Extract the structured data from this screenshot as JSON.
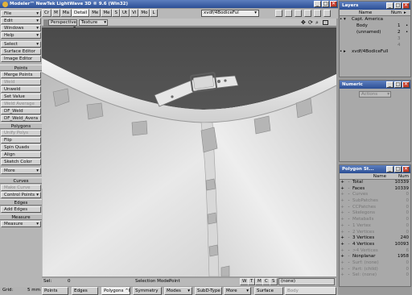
{
  "title_bar": {
    "title": "Modeler™ NewTek LightWave 3D ® 9.6  (Win32)",
    "controls": [
      "_",
      "□",
      "✕"
    ]
  },
  "tabs": [
    "Cr",
    "M",
    "Ma",
    "Me",
    "Me",
    "S",
    "Ut",
    "Vi",
    "Mo",
    "L"
  ],
  "layer_select": "xvdf/4BodiceFul",
  "left_menu": {
    "top": [
      "File",
      "Edit",
      "Windows",
      "Help"
    ],
    "tools": [
      "Select",
      "Surface Editor",
      "Image Editor"
    ],
    "points_header": "Points",
    "points": [
      "Merge Points",
      "Weld",
      "Unweld",
      "Set Value",
      "Weld Average",
      "DF_Weld",
      "DF_Weld_Avera"
    ],
    "points_disabled": [
      false,
      true,
      false,
      false,
      true,
      false,
      false
    ],
    "polygons_header": "Polygons",
    "polygons": [
      "Unify Polys",
      "Flip",
      "Spin Quads",
      "Align",
      "Sketch Color"
    ],
    "polygons_disabled": [
      true,
      false,
      false,
      false,
      false
    ],
    "more1": "More",
    "curves_header": "Curves",
    "curves": [
      "Make Curve",
      "Control Points"
    ],
    "edges_header": "Edges",
    "edges": [
      "Add Edges"
    ],
    "measure_header": "Measure",
    "measure": [
      "Measure"
    ]
  },
  "viewport": {
    "view_type": "Perspective",
    "shading": "Texture",
    "toggle": "Detail"
  },
  "status": {
    "sel_label": "Sel:",
    "sel_value": "0",
    "mode_label": "Selection Mode:",
    "mode_value": "Point",
    "buttons": [
      "W",
      "T",
      "M",
      "C",
      "S"
    ],
    "none": "(none)"
  },
  "bottom": {
    "grid_label": "Grid:",
    "grid_value": "5 mm",
    "points": "Points",
    "edges": "Edges",
    "polygons": "Polygons",
    "ph": "^H",
    "symmetry": "Symmetry",
    "modes": "Modes",
    "subd": "SubD-Type",
    "more": "More",
    "surface": "Surface",
    "surface_value": "Body"
  },
  "layers": {
    "title": "Layers",
    "col_name": "Name",
    "col_num": "Num",
    "rows": [
      {
        "name": "Capt. America",
        "num": ""
      },
      {
        "name": "Body",
        "num": "1"
      },
      {
        "name": "(unnamed)",
        "num": "2"
      },
      {
        "name": "",
        "num": "3"
      },
      {
        "name": "",
        "num": "4"
      },
      {
        "name": "xvdf/4BodiceFull",
        "num": ""
      }
    ]
  },
  "numeric": {
    "title": "Numeric",
    "actions": "Actions"
  },
  "poly_stats": {
    "title": "Polygon St...",
    "col_name": "Name",
    "col_num": "Num",
    "rows": [
      {
        "name": "Total",
        "num": "10339",
        "dim": false
      },
      {
        "name": "Faces",
        "num": "10339",
        "dim": false
      },
      {
        "name": "Curves",
        "num": "0",
        "dim": true
      },
      {
        "name": "SubPatches",
        "num": "0",
        "dim": true
      },
      {
        "name": "CCPatches",
        "num": "0",
        "dim": true
      },
      {
        "name": "Skelegons",
        "num": "0",
        "dim": true
      },
      {
        "name": "Metaballs",
        "num": "0",
        "dim": true
      },
      {
        "name": "1 Vertex",
        "num": "0",
        "dim": true
      },
      {
        "name": "2 Vertices",
        "num": "0",
        "dim": true
      },
      {
        "name": "3 Vertices",
        "num": "240",
        "dim": false
      },
      {
        "name": "4 Vertices",
        "num": "10093",
        "dim": false
      },
      {
        "name": ">4 Vertices",
        "num": "6",
        "dim": true
      },
      {
        "name": "Nonplanar",
        "num": "1958",
        "dim": false
      },
      {
        "name": "Surf: (none)",
        "num": "0",
        "dim": true
      },
      {
        "name": "Part: (child)",
        "num": "0",
        "dim": true
      },
      {
        "name": "Sel: (none)",
        "num": "0",
        "dim": true
      }
    ]
  }
}
